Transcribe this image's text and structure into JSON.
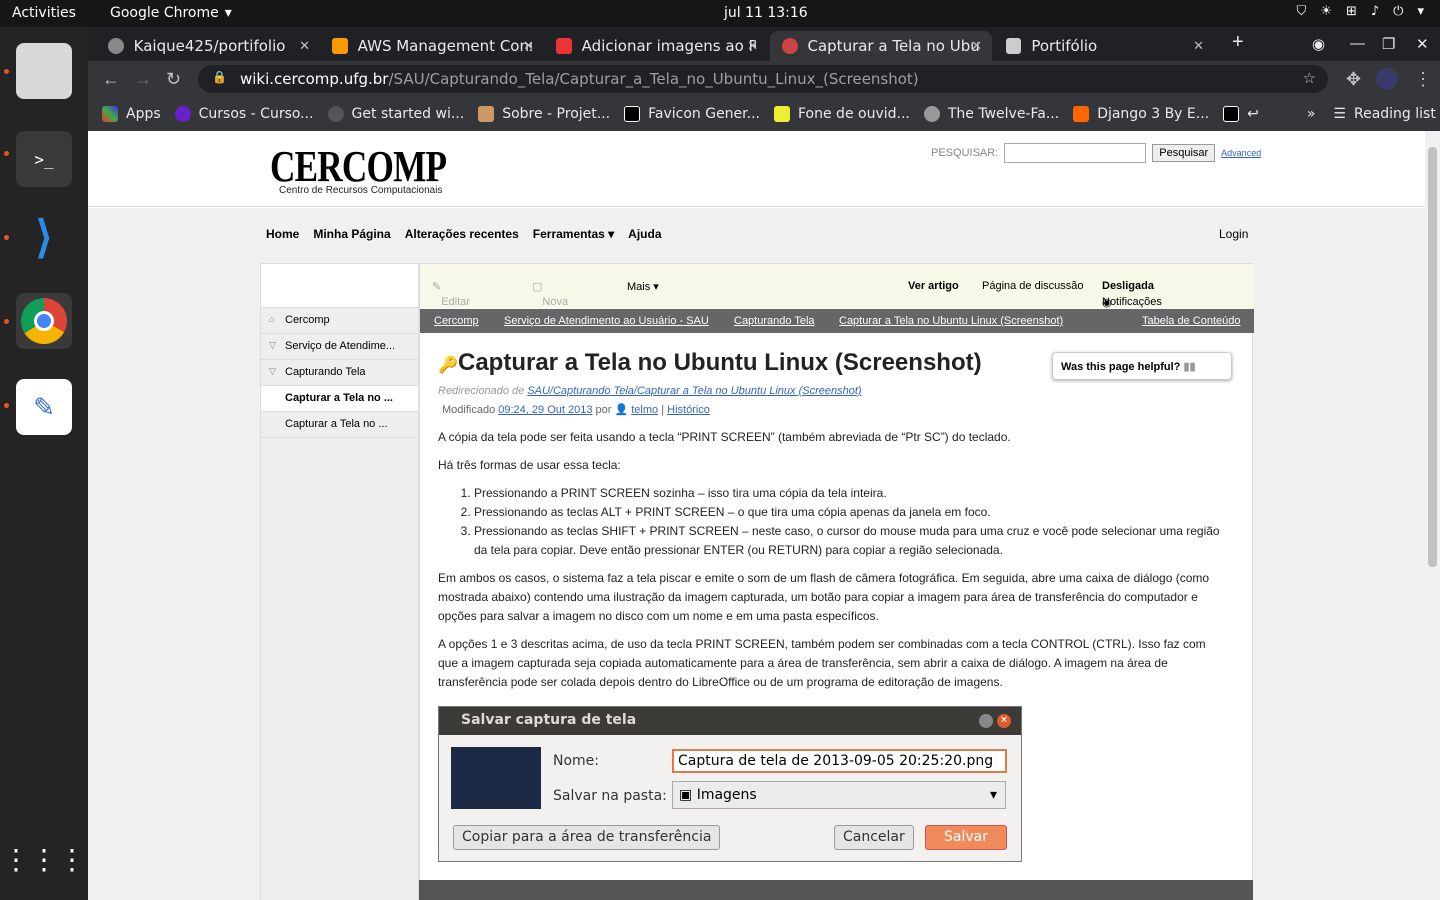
{
  "topbar": {
    "activities": "Activities",
    "app": "Google Chrome",
    "clock": "jul 11  13:16"
  },
  "tabs": [
    {
      "title": "Kaique425/portifolio",
      "color": "#888"
    },
    {
      "title": "AWS Management Cons",
      "color": "#f90"
    },
    {
      "title": "Adicionar imagens ao R",
      "color": "#e33"
    },
    {
      "title": "Capturar a Tela no Ubun",
      "color": "#c44"
    },
    {
      "title": "Portifólio",
      "color": "#ccc"
    }
  ],
  "omnibox": {
    "host": "wiki.cercomp.ufg.br",
    "path": "/SAU/Capturando_Tela/Capturar_a_Tela_no_Ubuntu_Linux_(Screenshot)"
  },
  "bookmarks": [
    "Apps",
    "Cursos - Curso...",
    "Get started wi...",
    "Sobre - Projet...",
    "Favicon Gener...",
    "Fone de ouvid...",
    "The Twelve-Fa...",
    "Django 3 By E..."
  ],
  "reading_list": "Reading list",
  "site": {
    "logo": "CERCOMP",
    "logo_sub": "Centro de Recursos Computacionais",
    "search_label": "PESQUISAR:",
    "search_button": "Pesquisar",
    "advanced": "Advanced",
    "menu": [
      "Home",
      "Minha Página",
      "Alterações recentes",
      "Ferramentas ▾",
      "Ajuda"
    ],
    "login": "Login",
    "sidebar": [
      "Cercomp",
      "Serviço de Atendime...",
      "Capturando Tela",
      "Capturar a Tela no ...",
      "Capturar a Tela no ..."
    ],
    "actions": {
      "edit": "Editar página",
      "new": "Nova página",
      "more": "Mais ▾",
      "article": "Ver artigo",
      "discussion": "Página de discussão",
      "notif": "Notificações",
      "notif_state": "Desligada"
    },
    "crumbs": [
      "Cercomp",
      "Serviço de Atendimento ao Usuário - SAU",
      "Capturando Tela",
      "Capturar a Tela no Ubuntu Linux (Screenshot)"
    ],
    "toc": "Tabela de Conteúdo",
    "title": "Capturar a Tela no Ubuntu Linux (Screenshot)",
    "helpful": "Was this page helpful?",
    "redirect_prefix": "Redirecionado de ",
    "redirect_link": "SAU/Capturando Tela/Capturar a Tela no Ubuntu Linux (Screenshot)",
    "mod_prefix": "Modificado ",
    "mod_date": "09:24, 29 Out 2013",
    "mod_by": " por ",
    "mod_user": "telmo",
    "mod_hist": "Histórico",
    "p1": "A cópia da tela pode ser feita usando a tecla “PRINT SCREEN” (também abreviada de “Ptr SC”) do teclado.",
    "p2": "Há três formas de usar essa tecla:",
    "list": [
      "Pressionando a PRINT SCREEN sozinha – isso tira uma cópia da tela inteira.",
      "Pressionando as teclas ALT + PRINT SCREEN – o que tira uma cópia apenas da janela em foco.",
      "Pressionando as teclas SHIFT + PRINT SCREEN – neste caso, o cursor do mouse muda para uma cruz e você pode selecionar uma região da tela para copiar. Deve então pressionar ENTER (ou RETURN) para copiar a região selecionada."
    ],
    "p3": "Em ambos os casos, o sistema faz a tela piscar e emite o som de um flash de câmera fotográfica. Em seguida, abre uma caixa de diálogo (como mostrada abaixo) contendo uma ilustração da imagem capturada, um botão para copiar a imagem para área de transferência do computador e opções para salvar a imagem no disco com um nome e em uma pasta específicos.",
    "p4": "A opções 1 e 3 descritas acima, de uso da tecla PRINT SCREEN, também podem ser combinadas com a tecla CONTROL (CTRL). Isso faz com que a imagem capturada seja copiada automaticamente para a área de transferência, sem abrir a caixa de diálogo. A imagem na área de transferência pode ser colada depois dentro do LibreOffice ou de um programa de editoração de imagens.",
    "dialog": {
      "title": "Salvar captura de tela",
      "name_label": "Nome:",
      "name_value": "Captura de tela de 2013-09-05 20:25:20.png",
      "folder_label": "Salvar na pasta:",
      "folder_value": "Imagens",
      "copy": "Copiar para a área de transferência",
      "cancel": "Cancelar",
      "save": "Salvar"
    }
  }
}
